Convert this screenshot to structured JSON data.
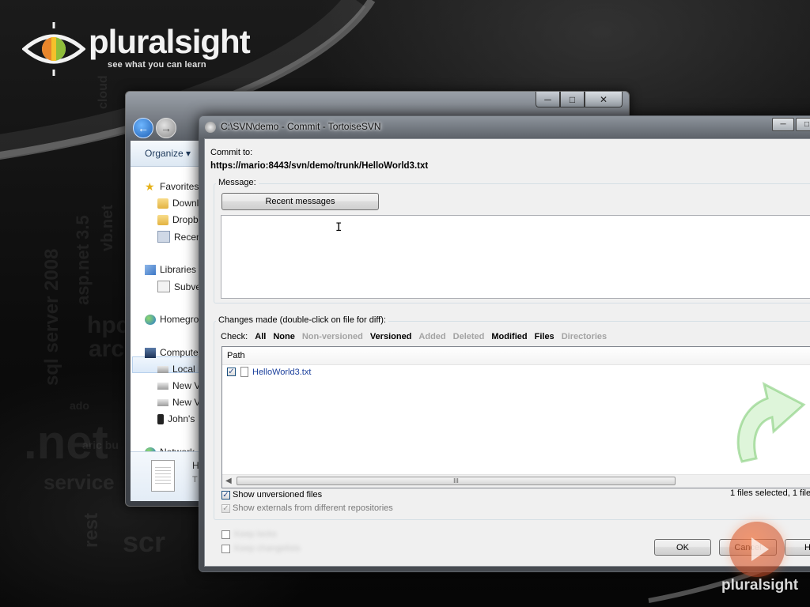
{
  "brand": {
    "logo_text": "pluralsight",
    "tagline": "see what you can learn",
    "corner_logo_text": "pluralsight",
    "accent_color": "#f07a3a"
  },
  "background_words": [
    ".net",
    "sql server 2008",
    "asp.net 3.5",
    "hpc",
    "arc",
    "service",
    "rest",
    "scr",
    "vb.net",
    "cloud",
    "ado",
    "aric bu"
  ],
  "explorer": {
    "caption_buttons": [
      "minimize",
      "maximize",
      "close"
    ],
    "toolbar": {
      "organize_label": "Organize ▾"
    },
    "nav_items": [
      {
        "label": "Favorites",
        "icon": "star-icon"
      },
      {
        "label": "Downloads",
        "icon": "folder-icon"
      },
      {
        "label": "Dropbox",
        "icon": "folder-icon"
      },
      {
        "label": "Recent Places",
        "icon": "recent-places-icon"
      },
      {
        "label": "Libraries",
        "icon": "library-icon"
      },
      {
        "label": "Subversion",
        "icon": "document-icon"
      },
      {
        "label": "Homegroup",
        "icon": "homegroup-icon"
      },
      {
        "label": "Computer",
        "icon": "computer-icon"
      },
      {
        "label": "Local Disk (C:)",
        "icon": "drive-icon"
      },
      {
        "label": "New Volume",
        "icon": "drive-icon"
      },
      {
        "label": "New Volume",
        "icon": "drive-icon"
      },
      {
        "label": "John's",
        "icon": "phone-icon"
      },
      {
        "label": "Network",
        "icon": "network-icon"
      }
    ],
    "details": {
      "name": "H",
      "type": "T"
    }
  },
  "dialog": {
    "title": "C:\\SVN\\demo - Commit - TortoiseSVN",
    "commit_to_label": "Commit to:",
    "commit_url": "https://mario:8443/svn/demo/trunk/HelloWorld3.txt",
    "message_group_label": "Message:",
    "recent_messages_button": "Recent messages",
    "message_value": "",
    "changes_group_label": "Changes made (double-click on file for diff):",
    "check_label": "Check:",
    "filters": [
      {
        "label": "All",
        "enabled": true
      },
      {
        "label": "None",
        "enabled": true
      },
      {
        "label": "Non-versioned",
        "enabled": false
      },
      {
        "label": "Versioned",
        "enabled": true
      },
      {
        "label": "Added",
        "enabled": false
      },
      {
        "label": "Deleted",
        "enabled": false
      },
      {
        "label": "Modified",
        "enabled": true
      },
      {
        "label": "Files",
        "enabled": true
      },
      {
        "label": "Directories",
        "enabled": false
      }
    ],
    "list_column_path": "Path",
    "files": [
      {
        "path": "HelloWorld3.txt",
        "checked": true
      }
    ],
    "scrollbar_grip": "III",
    "show_unversioned_label": "Show unversioned files",
    "show_unversioned_checked": true,
    "show_externals_label": "Show externals from different repositories",
    "show_externals_checked": true,
    "status_text": "1 files selected, 1 file",
    "blurred_option_1": "Keep locks",
    "blurred_option_2": "Keep changelists",
    "ok_button": "OK",
    "cancel_button": "Cancel",
    "help_button": "H"
  }
}
